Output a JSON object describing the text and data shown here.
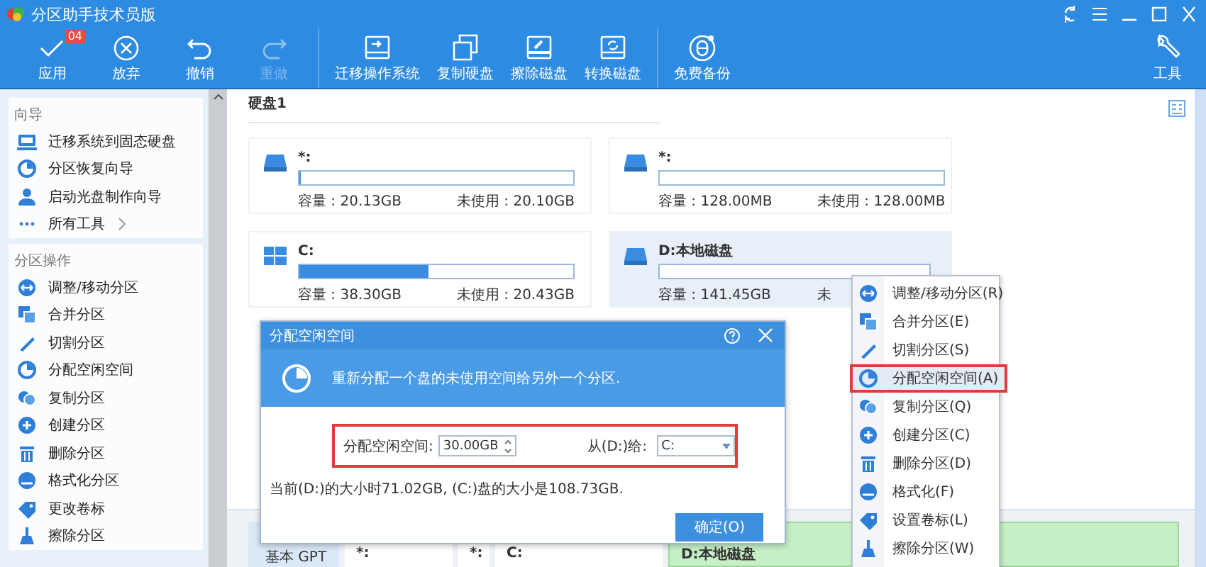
{
  "window": {
    "title": "分区助手技术员版"
  },
  "toolbar": {
    "groups": [
      {
        "items": [
          {
            "label": "应用",
            "badge": "04",
            "disabled": false
          },
          {
            "label": "放弃",
            "disabled": false
          },
          {
            "label": "撤销",
            "disabled": false
          },
          {
            "label": "重做",
            "disabled": true
          }
        ]
      },
      {
        "items": [
          {
            "label": "迁移操作系统",
            "disabled": false
          },
          {
            "label": "复制硬盘",
            "disabled": false
          },
          {
            "label": "擦除磁盘",
            "disabled": false
          },
          {
            "label": "转换磁盘",
            "disabled": false
          }
        ]
      },
      {
        "items": [
          {
            "label": "免费备份",
            "disabled": false
          }
        ]
      }
    ],
    "right_item": {
      "label": "工具"
    }
  },
  "sidebar": {
    "sections": [
      {
        "title": "向导",
        "items": [
          {
            "label": "迁移系统到固态硬盘",
            "submenu": false
          },
          {
            "label": "分区恢复向导",
            "submenu": false
          },
          {
            "label": "启动光盘制作向导",
            "submenu": false
          },
          {
            "label": "所有工具",
            "submenu": true
          }
        ]
      },
      {
        "title": "分区操作",
        "items": [
          {
            "label": "调整/移动分区",
            "submenu": false
          },
          {
            "label": "合并分区",
            "submenu": false
          },
          {
            "label": "切割分区",
            "submenu": false
          },
          {
            "label": "分配空闲空间",
            "submenu": false
          },
          {
            "label": "复制分区",
            "submenu": false
          },
          {
            "label": "创建分区",
            "submenu": false
          },
          {
            "label": "删除分区",
            "submenu": false
          },
          {
            "label": "格式化分区",
            "submenu": false
          },
          {
            "label": "更改卷标",
            "submenu": false
          },
          {
            "label": "擦除分区",
            "submenu": false
          }
        ]
      }
    ]
  },
  "disk": {
    "title": "硬盘1",
    "partitions": [
      {
        "kind": "data",
        "name": "*:",
        "level": 0.002,
        "capacity": "容量 : 20.13GB",
        "unused": "未使用 : 20.10GB",
        "selected": false
      },
      {
        "kind": "data",
        "name": "*:",
        "level": 0,
        "capacity": "容量 : 128.00MB",
        "unused": "未使用 : 128.00MB",
        "selected": false
      },
      {
        "kind": "system",
        "name": "C:",
        "level": 0.47,
        "capacity": "容量 : 38.30GB",
        "unused": "未使用 : 20.43GB",
        "selected": false
      },
      {
        "kind": "data",
        "name": "D:本地磁盘",
        "level": 0,
        "capacity": "容量 : 141.45GB",
        "unused": "未",
        "selected": true
      }
    ]
  },
  "disk_map": {
    "label": "基本 GPT",
    "partitions": [
      {
        "name": "*:",
        "selected": false
      },
      {
        "name": "*:",
        "selected": false
      },
      {
        "name": "C:",
        "selected": false
      },
      {
        "name": "D:本地磁盘",
        "selected": true
      }
    ]
  },
  "dialog": {
    "title": "分配空闲空间",
    "description": "重新分配一个盘的未使用空间给另外一个分区.",
    "size_label": "分配空闲空间:",
    "size_value": "30.00GB",
    "from_label": "从(D:)给:",
    "target_value": "C:",
    "info": "当前(D:)的大小时71.02GB, (C:)盘的大小是108.73GB.",
    "ok_button": "确定(O)"
  },
  "context_menu": {
    "items": [
      {
        "label": "调整/移动分区(R)",
        "selected": false
      },
      {
        "label": "合并分区(E)",
        "selected": false
      },
      {
        "label": "切割分区(S)",
        "selected": false
      },
      {
        "label": "分配空闲空间(A)",
        "selected": true
      },
      {
        "label": "复制分区(Q)",
        "selected": false
      },
      {
        "label": "创建分区(C)",
        "selected": false
      },
      {
        "label": "删除分区(D)",
        "selected": false
      },
      {
        "label": "格式化(F)",
        "selected": false
      },
      {
        "label": "设置卷标(L)",
        "selected": false
      },
      {
        "label": "擦除分区(W)",
        "selected": false
      }
    ]
  }
}
